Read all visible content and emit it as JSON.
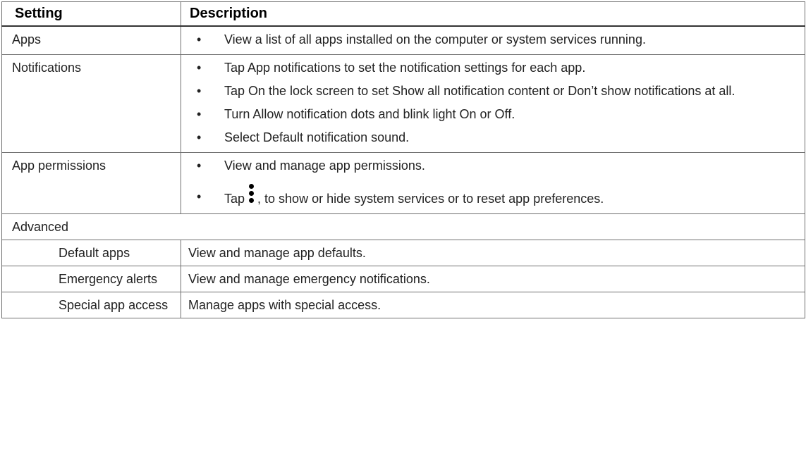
{
  "header": {
    "setting": "Setting",
    "description": "Description"
  },
  "rows": {
    "apps": {
      "setting": "Apps",
      "bullets": [
        "View a list of all apps installed on the computer or system services running."
      ]
    },
    "notifications": {
      "setting": "Notifications",
      "bullets": [
        "Tap App notifications to set the notification settings for each app.",
        "Tap On the lock screen to set Show all notification content or Don’t show notifications at all.",
        "Turn Allow notification dots and blink light On or Off.",
        "Select Default notification sound."
      ]
    },
    "app_permissions": {
      "setting": "App permissions",
      "bullet1": "View and manage app permissions.",
      "bullet2_before": "Tap",
      "bullet2_icon": "more-vert-icon",
      "bullet2_after": ", to show or hide system services or to reset app preferences."
    },
    "advanced": {
      "label": "Advanced"
    },
    "default_apps": {
      "setting": "Default apps",
      "description": "View and manage app defaults."
    },
    "emergency_alerts": {
      "setting": "Emergency alerts",
      "description": "View and manage emergency notifications."
    },
    "special_app_access": {
      "setting": "Special app access",
      "description": "Manage apps with special access."
    }
  },
  "bullet_char": "•"
}
